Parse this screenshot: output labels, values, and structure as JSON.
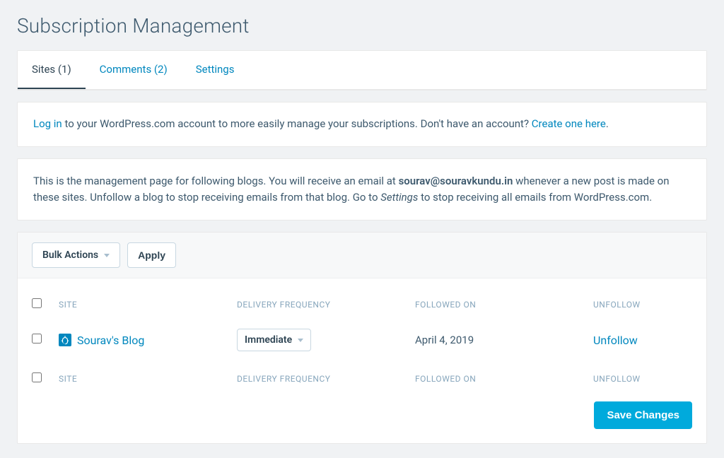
{
  "page_title": "Subscription Management",
  "tabs": {
    "sites": "Sites (1)",
    "comments": "Comments (2)",
    "settings": "Settings"
  },
  "login_notice": {
    "login_link": "Log in",
    "text_1": " to your WordPress.com account to more easily manage your subscriptions. Don't have an account? ",
    "create_link": "Create one here",
    "period": "."
  },
  "description": {
    "part1": "This is the management page for following blogs. You will receive an email at ",
    "email": "sourav@souravkundu.in",
    "part2": " whenever a new post is made on these sites. Unfollow a blog to stop receiving emails from that blog. Go to ",
    "settings_word": "Settings",
    "part3": " to stop receiving all emails from WordPress.com."
  },
  "bulk": {
    "label": "Bulk Actions",
    "apply": "Apply"
  },
  "columns": {
    "site": "SITE",
    "frequency": "DELIVERY FREQUENCY",
    "followed": "FOLLOWED ON",
    "unfollow": "UNFOLLOW"
  },
  "rows": [
    {
      "site_name": "Sourav's Blog",
      "frequency": "Immediate",
      "followed_on": "April 4, 2019",
      "unfollow_label": "Unfollow"
    }
  ],
  "save_button": "Save Changes"
}
